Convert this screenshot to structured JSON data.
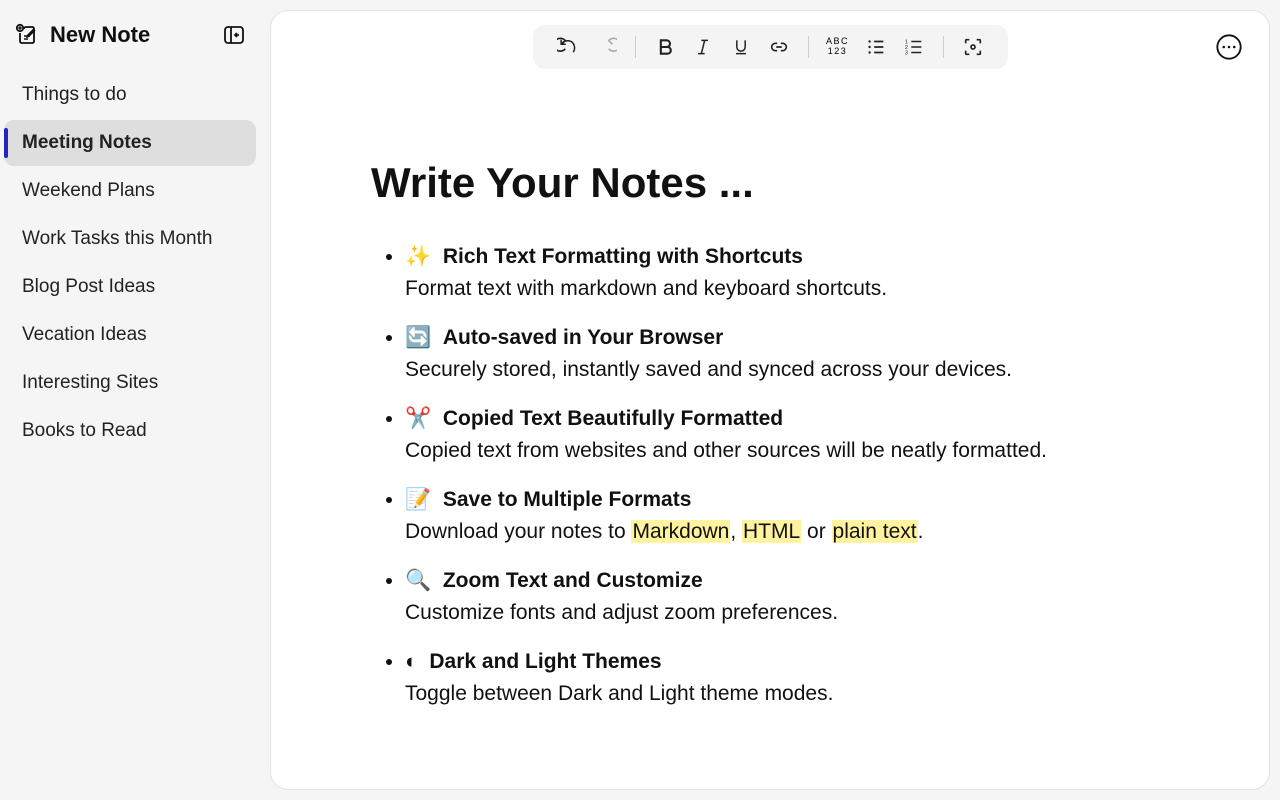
{
  "sidebar": {
    "new_note_label": "New Note",
    "items": [
      {
        "label": "Things to do",
        "selected": false
      },
      {
        "label": "Meeting Notes",
        "selected": true
      },
      {
        "label": "Weekend Plans",
        "selected": false
      },
      {
        "label": "Work Tasks this Month",
        "selected": false
      },
      {
        "label": "Blog Post Ideas",
        "selected": false
      },
      {
        "label": "Vecation Ideas",
        "selected": false
      },
      {
        "label": "Interesting Sites",
        "selected": false
      },
      {
        "label": "Books to Read",
        "selected": false
      }
    ]
  },
  "toolbar": {
    "spell_line1": "ABC",
    "spell_line2": "123"
  },
  "content": {
    "heading": "Write Your Notes ...",
    "features": [
      {
        "emoji": "✨",
        "title": "Rich Text Formatting with Shortcuts",
        "desc": "Format text with markdown and keyboard shortcuts."
      },
      {
        "emoji": "🔄",
        "title": "Auto-saved in Your Browser",
        "desc": "Securely stored, instantly saved and synced across your devices."
      },
      {
        "emoji": "✂️",
        "title": "Copied Text Beautifully Formatted",
        "desc": "Copied text from websites and other sources will be neatly formatted."
      },
      {
        "emoji": "📝",
        "title": "Save to Multiple Formats",
        "desc_pre": "Download your notes to ",
        "hl1": "Markdown",
        "mid1": ", ",
        "hl2": "HTML",
        "mid2": " or ",
        "hl3": "plain text",
        "desc_post": "."
      },
      {
        "emoji": "🔍",
        "title": "Zoom Text and Customize",
        "desc": "Customize fonts and adjust zoom preferences."
      },
      {
        "emoji": "◐",
        "title": "Dark and Light Themes",
        "desc": "Toggle between Dark and Light theme modes."
      }
    ]
  }
}
